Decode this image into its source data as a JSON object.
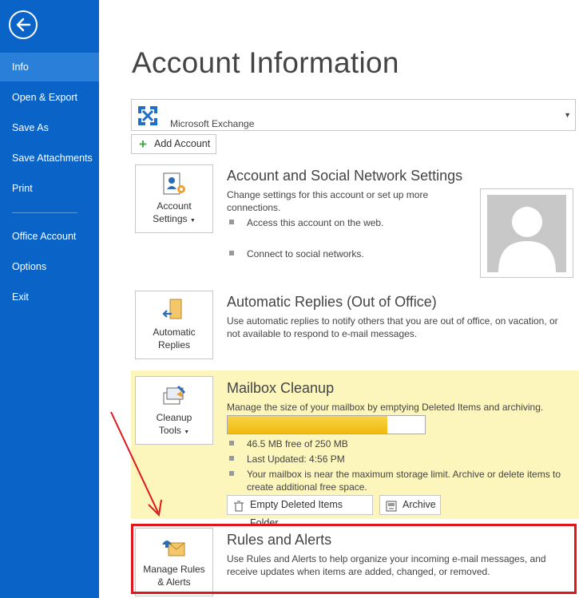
{
  "sidebar": {
    "items": [
      {
        "label": "Info",
        "active": true
      },
      {
        "label": "Open & Export"
      },
      {
        "label": "Save As"
      },
      {
        "label": "Save Attachments"
      },
      {
        "label": "Print"
      },
      {
        "label": "Office Account"
      },
      {
        "label": "Options"
      },
      {
        "label": "Exit"
      }
    ]
  },
  "page": {
    "title": "Account Information",
    "account_name": "Microsoft Exchange",
    "add_account_label": "Add Account"
  },
  "sections": {
    "account_settings": {
      "tile_label_1": "Account",
      "tile_label_2": "Settings",
      "title": "Account and Social Network Settings",
      "desc": "Change settings for this account or set up more connections.",
      "bullets": [
        "Access this account on the web.",
        "Connect to social networks."
      ]
    },
    "auto_replies": {
      "tile_label_1": "Automatic",
      "tile_label_2": "Replies",
      "title": "Automatic Replies (Out of Office)",
      "desc": "Use automatic replies to notify others that you are out of office, on vacation, or not available to respond to e-mail messages."
    },
    "mailbox_cleanup": {
      "tile_label_1": "Cleanup",
      "tile_label_2": "Tools",
      "title": "Mailbox Cleanup",
      "desc": "Manage the size of your mailbox by emptying Deleted Items and archiving.",
      "usage_fraction": 0.81,
      "bullets": [
        "46.5 MB free of 250 MB",
        "Last Updated: 4:56 PM",
        "Your mailbox is near the maximum storage limit. Archive or delete items to create additional free space."
      ],
      "empty_btn": "Empty Deleted Items Folder",
      "archive_btn": "Archive"
    },
    "rules_alerts": {
      "tile_label_1": "Manage Rules",
      "tile_label_2": "& Alerts",
      "title": "Rules and Alerts",
      "desc": "Use Rules and Alerts to help organize your incoming e-mail messages, and receive updates when items are added, changed, or removed."
    }
  },
  "colors": {
    "sidebar": "#0a64c8",
    "highlight_box": "#e0161b",
    "cleanup_bg": "#fcf6bd"
  }
}
